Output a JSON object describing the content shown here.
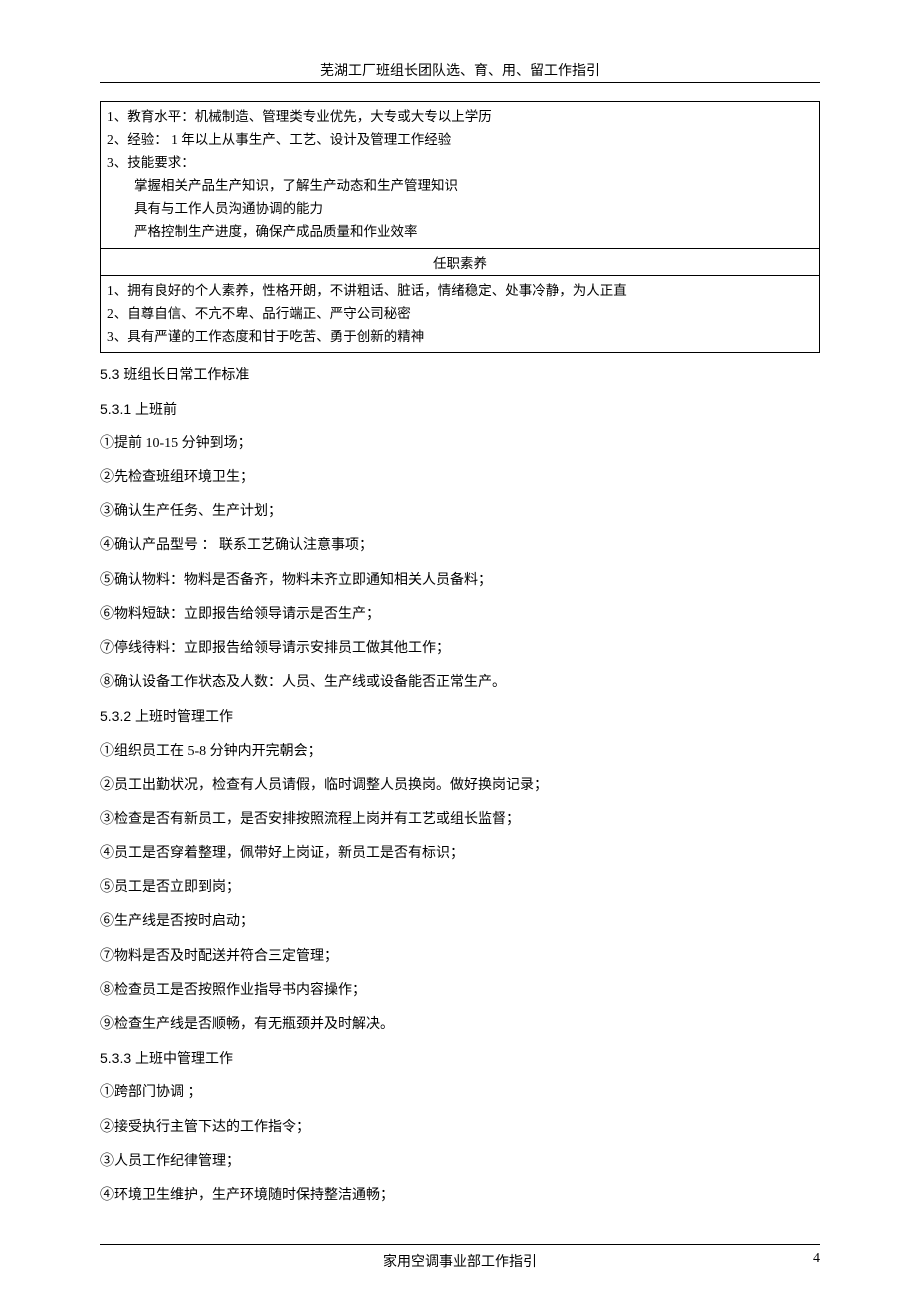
{
  "header": {
    "title": "芜湖工厂班组长团队选、育、用、留工作指引"
  },
  "footer": {
    "center": "家用空调事业部工作指引",
    "page_number": "4"
  },
  "box1": {
    "lines": [
      "1、教育水平：机械制造、管理类专业优先，大专或大专以上学历",
      "2、经验： 1 年以上从事生产、工艺、设计及管理工作经验",
      "3、技能要求："
    ],
    "sub_lines": [
      "掌握相关产品生产知识，了解生产动态和生产管理知识",
      "具有与工作人员沟通协调的能力",
      "严格控制生产进度，确保产成品质量和作业效率"
    ],
    "divider": "任职素养",
    "lines2": [
      "1、拥有良好的个人素养，性格开朗，不讲粗话、脏话，情绪稳定、处事冷静，为人正直",
      "2、自尊自信、不亢不卑、品行端正、严守公司秘密",
      "3、具有严谨的工作态度和甘于吃苦、勇于创新的精神"
    ]
  },
  "sections": {
    "s53": "5.3   班组长日常工作标准",
    "s531": "5.3.1   上班前",
    "s531_items": [
      "①提前  10-15  分钟到场；",
      "②先检查班组环境卫生；",
      "③确认生产任务、生产计划；",
      "④确认产品型号   ：  联系工艺确认注意事项；",
      "⑤确认物料：物料是否备齐，物料未齐立即通知相关人员备料；",
      "⑥物料短缺：立即报告给领导请示是否生产；",
      "⑦停线待料：立即报告给领导请示安排员工做其他工作；",
      "⑧确认设备工作状态及人数：人员、生产线或设备能否正常生产。"
    ],
    "s532": "5.3.2   上班时管理工作",
    "s532_items": [
      "①组织员工在   5-8 分钟内开完朝会；",
      "②员工出勤状况，检查有人员请假，临时调整人员换岗。做好换岗记录；",
      "③检查是否有新员工，是否安排按照流程上岗并有工艺或组长监督；",
      "④员工是否穿着整理，佩带好上岗证，新员工是否有标识；",
      "⑤员工是否立即到岗；",
      "⑥生产线是否按时启动；",
      "⑦物料是否及时配送并符合三定管理；",
      "⑧检查员工是否按照作业指导书内容操作；",
      "⑨检查生产线是否顺畅，有无瓶颈并及时解决。"
    ],
    "s533": "5.3.3   上班中管理工作",
    "s533_items": [
      "①跨部门协调 ；",
      "②接受执行主管下达的工作指令；",
      "③人员工作纪律管理；",
      "④环境卫生维护，生产环境随时保持整洁通畅；"
    ]
  }
}
